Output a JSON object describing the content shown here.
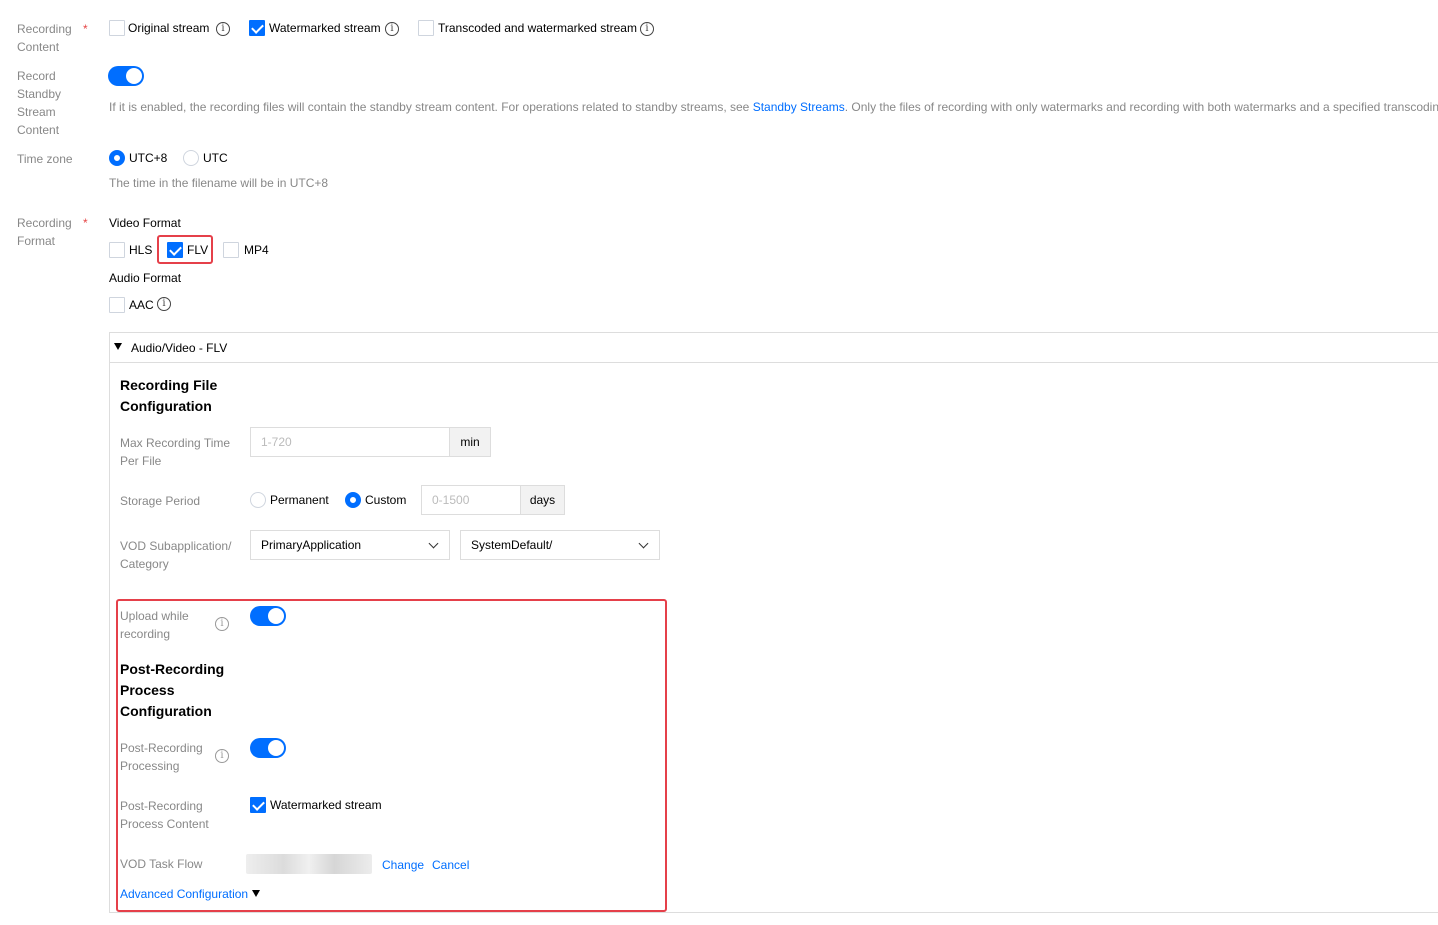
{
  "recording_content": {
    "label": "Recording Content",
    "required_mark": "*",
    "options": [
      {
        "label": "Original stream",
        "checked": false
      },
      {
        "label": "Watermarked stream",
        "checked": true
      },
      {
        "label": "Transcoded and watermarked stream",
        "checked": false
      }
    ]
  },
  "standby": {
    "label": "Record Standby Stream Content",
    "enabled": true,
    "hint_before": "If it is enabled, the recording files will contain the standby stream content. For operations related to standby streams, see",
    "hint_link": "Standby Streams",
    "hint_after": ". Only the files of recording with only watermarks and recording with both watermarks and a specified transcoding"
  },
  "timezone": {
    "label": "Time zone",
    "options": [
      {
        "label": "UTC+8",
        "selected": true
      },
      {
        "label": "UTC",
        "selected": false
      }
    ],
    "hint": "The time in the filename will be in UTC+8"
  },
  "recording_format": {
    "label": "Recording Format",
    "required_mark": "*",
    "video_label": "Video Format",
    "video_options": [
      {
        "label": "HLS",
        "checked": false
      },
      {
        "label": "FLV",
        "checked": true
      },
      {
        "label": "MP4",
        "checked": false
      }
    ],
    "audio_label": "Audio Format",
    "audio_options": [
      {
        "label": "AAC",
        "checked": false
      }
    ]
  },
  "panel": {
    "title": "Audio/Video - FLV",
    "file_config_title": "Recording File Configuration",
    "max_time": {
      "label": "Max Recording Time Per File",
      "placeholder": "1-720",
      "unit": "min"
    },
    "storage": {
      "label": "Storage Period",
      "options": [
        {
          "label": "Permanent",
          "selected": false
        },
        {
          "label": "Custom",
          "selected": true
        }
      ],
      "placeholder": "0-1500",
      "unit": "days"
    },
    "vod": {
      "label": "VOD Subapplication/Category",
      "subapp": "PrimaryApplication",
      "category": "SystemDefault/"
    },
    "upload": {
      "label": "Upload while recording",
      "enabled": true
    },
    "post_title": "Post-Recording Process Configuration",
    "post_processing": {
      "label": "Post-Recording Processing",
      "enabled": true
    },
    "post_content": {
      "label": "Post-Recording Process Content",
      "option": "Watermarked stream",
      "checked": true
    },
    "task_flow": {
      "label": "VOD Task Flow",
      "change": "Change",
      "cancel": "Cancel"
    },
    "advanced": "Advanced Configuration"
  },
  "colors": {
    "accent": "#006eff",
    "highlight": "#e5404a",
    "label": "#888888"
  }
}
